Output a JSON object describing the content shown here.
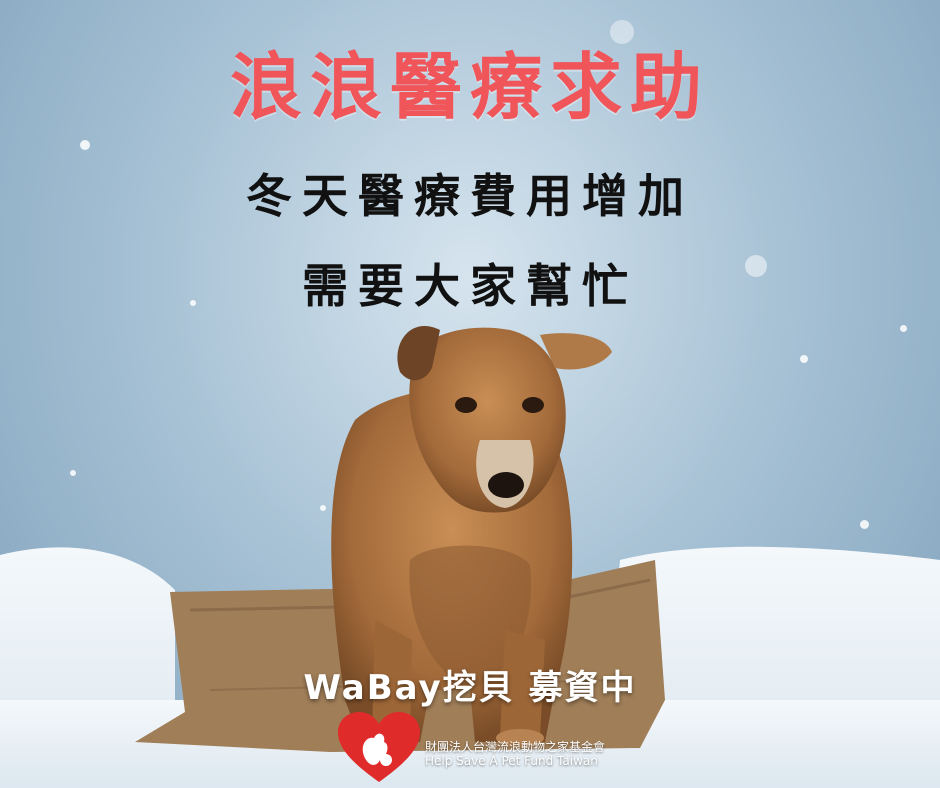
{
  "poster": {
    "title": "浪浪醫療求助",
    "subtitle_line1": "冬天醫療費用增加",
    "subtitle_line2": "需要大家幫忙",
    "fundraising": "WaBay挖貝 募資中",
    "org_name_zh": "財團法人台灣流浪動物之家基金會",
    "org_name_en": "Help Save A Pet Fund Taiwan"
  },
  "colors": {
    "title": "#f0555a",
    "subtitle": "#111111",
    "logo_heart": "#e02b2b"
  },
  "icons": [
    "heart-logo-icon",
    "dog-photo",
    "snowflake-icon"
  ]
}
